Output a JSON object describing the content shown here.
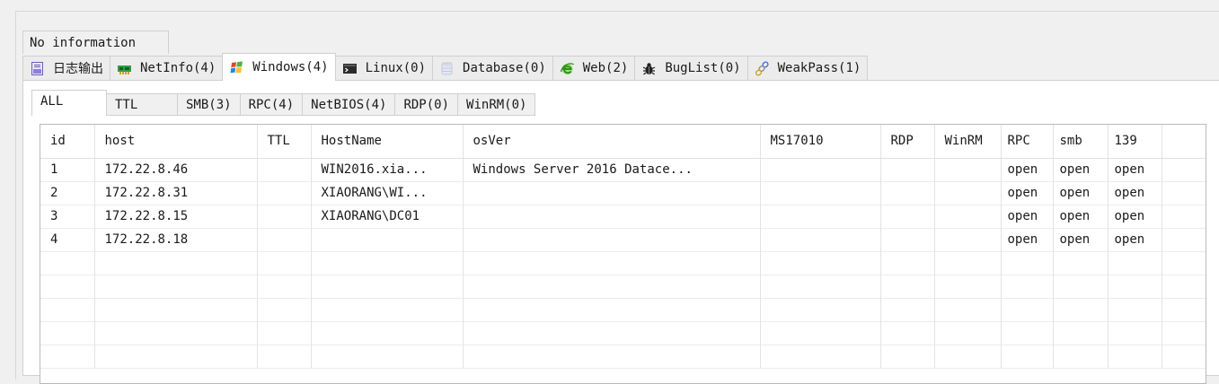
{
  "info_text": "No information",
  "main_tabs": [
    {
      "label": "日志输出",
      "icon": "log-doc-icon",
      "active": false
    },
    {
      "label": "NetInfo(4)",
      "icon": "network-card-icon",
      "active": false
    },
    {
      "label": "Windows(4)",
      "icon": "windows-logo-icon",
      "active": true
    },
    {
      "label": "Linux(0)",
      "icon": "terminal-icon",
      "active": false
    },
    {
      "label": "Database(0)",
      "icon": "database-icon",
      "active": false
    },
    {
      "label": "Web(2)",
      "icon": "browser-e-icon",
      "active": false
    },
    {
      "label": "BugList(0)",
      "icon": "bug-icon",
      "active": false
    },
    {
      "label": "WeakPass(1)",
      "icon": "key-chain-icon",
      "active": false
    }
  ],
  "sub_tabs": [
    {
      "label": "ALL",
      "active": true
    },
    {
      "label": "TTL",
      "active": false
    },
    {
      "label": "SMB(3)",
      "active": false
    },
    {
      "label": "RPC(4)",
      "active": false
    },
    {
      "label": "NetBIOS(4)",
      "active": false
    },
    {
      "label": "RDP(0)",
      "active": false
    },
    {
      "label": "WinRM(0)",
      "active": false
    }
  ],
  "table": {
    "columns": [
      "id",
      "host",
      "TTL",
      "HostName",
      "osVer",
      "MS17010",
      "RDP",
      "WinRM",
      "RPC",
      "smb",
      "139"
    ],
    "rows": [
      [
        "1",
        "172.22.8.46",
        "",
        "WIN2016.xia...",
        "Windows Server 2016 Datace...",
        "",
        "",
        "",
        "open",
        "open",
        "open"
      ],
      [
        "2",
        "172.22.8.31",
        "",
        "XIAORANG\\WI...",
        "",
        "",
        "",
        "",
        "open",
        "open",
        "open"
      ],
      [
        "3",
        "172.22.8.15",
        "",
        "XIAORANG\\DC01",
        "",
        "",
        "",
        "",
        "open",
        "open",
        "open"
      ],
      [
        "4",
        "172.22.8.18",
        "",
        "",
        "",
        "",
        "",
        "",
        "open",
        "open",
        "open"
      ]
    ],
    "empty_rows": 5
  }
}
